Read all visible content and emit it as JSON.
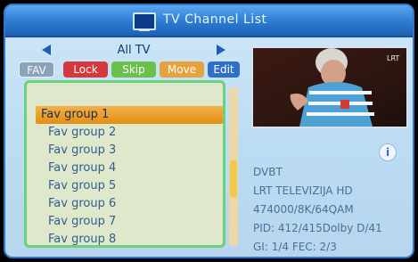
{
  "window": {
    "title": "TV Channel List"
  },
  "nav": {
    "category": "All TV"
  },
  "tabs": [
    {
      "label": "FAV",
      "color": "#8ca2b7"
    },
    {
      "label": "Lock",
      "color": "#d6393d"
    },
    {
      "label": "Skip",
      "color": "#69c04b"
    },
    {
      "label": "Move",
      "color": "#e6a23c"
    },
    {
      "label": "Edit",
      "color": "#2f6fc8"
    }
  ],
  "fav_groups": [
    {
      "label": "Fav group 1",
      "selected": true
    },
    {
      "label": "Fav group 2",
      "selected": false
    },
    {
      "label": "Fav group 3",
      "selected": false
    },
    {
      "label": "Fav group 4",
      "selected": false
    },
    {
      "label": "Fav group 5",
      "selected": false
    },
    {
      "label": "Fav group 6",
      "selected": false
    },
    {
      "label": "Fav group 7",
      "selected": false
    },
    {
      "label": "Fav group 8",
      "selected": false
    }
  ],
  "channel_info": {
    "standard": "DVBT",
    "channel_name": "LRT TELEVIZIJA HD",
    "frequency": "474000/8K/64QAM",
    "pid": "PID: 412/415Dolby D/41",
    "gi_fec": "GI: 1/4  FEC: 2/3"
  },
  "preview": {
    "logo_text": "LRT"
  },
  "colors": {
    "accent": "#2f7fd3",
    "highlight": "#e58f13",
    "list_border": "#6ad17e"
  },
  "icons": [
    "tv-icon",
    "left-arrow-icon",
    "right-arrow-icon",
    "info-icon"
  ]
}
